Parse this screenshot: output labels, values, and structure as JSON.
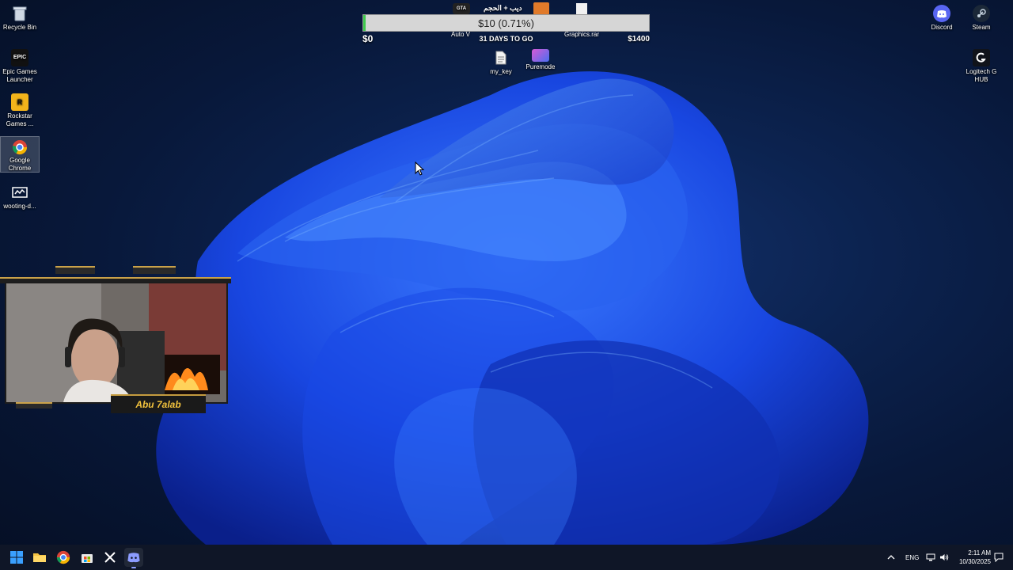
{
  "desktop": {
    "left_icons": [
      {
        "label": "Recycle Bin",
        "icon": "recycle-bin-icon"
      },
      {
        "label": "Epic Games Launcher",
        "icon": "epic-games-icon"
      },
      {
        "label": "Rockstar Games ...",
        "icon": "rockstar-icon"
      },
      {
        "label": "Google Chrome",
        "icon": "chrome-icon"
      },
      {
        "label": "wooting-d...",
        "icon": "wooting-icon"
      }
    ],
    "top_icons": [
      {
        "label": "Auto V",
        "icon": "gta-icon"
      },
      {
        "label": "Graphics.rar",
        "icon": "file-icon"
      },
      {
        "label": "my_key",
        "icon": "text-file-icon"
      },
      {
        "label": "Puremode",
        "icon": "puremode-icon"
      }
    ],
    "top_arabic_label": "ديب + الحجم",
    "right_icons": [
      {
        "label": "Discord",
        "icon": "discord-icon"
      },
      {
        "label": "Steam",
        "icon": "steam-icon"
      },
      {
        "label": "Logitech G HUB",
        "icon": "logitech-icon"
      }
    ]
  },
  "goal": {
    "text": "$10 (0.71%)",
    "progress_percent": 0.71,
    "min_label": "$0",
    "max_label": "$1400",
    "days_label": "31 DAYS TO GO"
  },
  "webcam": {
    "name": "Abu 7alab"
  },
  "taskbar": {
    "apps": [
      "start-icon",
      "file-explorer-icon",
      "chrome-icon",
      "store-icon",
      "x-icon",
      "discord-icon"
    ],
    "language": "ENG",
    "time": "2:11 AM",
    "date": "10/30/2025"
  },
  "colors": {
    "goal_fill": "#3ec94d",
    "name_text": "#f2c23d",
    "taskbar_bg": "#0f1627"
  }
}
